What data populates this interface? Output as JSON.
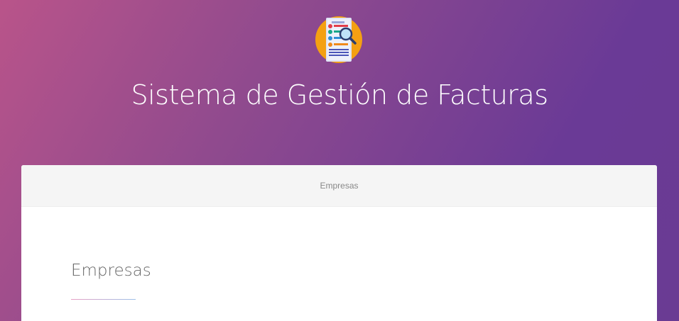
{
  "header": {
    "logo_icon": "invoice-search-icon",
    "title": "Sistema de Gestión de Facturas"
  },
  "card": {
    "header_label": "Empresas",
    "section_title": "Empresas"
  },
  "colors": {
    "gradient_start": "#b9548a",
    "gradient_end": "#6a3a96",
    "logo_circle": "#f4a012"
  }
}
